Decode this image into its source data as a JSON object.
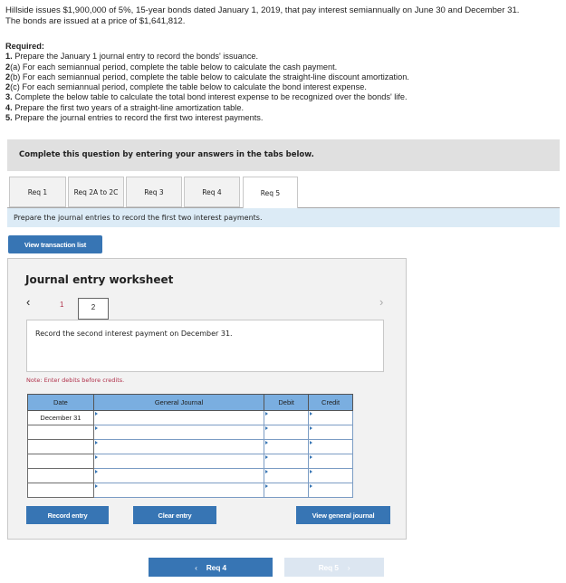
{
  "intro": {
    "line1": "Hillside issues $1,900,000 of 5%, 15-year bonds dated January 1, 2019, that pay interest semiannually on June 30 and December 31.",
    "line2": "The bonds are issued at a price of $1,641,812."
  },
  "required": {
    "heading": "Required:",
    "items": [
      {
        "num": "1.",
        "text": " Prepare the January 1 journal entry to record the bonds' issuance."
      },
      {
        "num": "2",
        "text": "(a) For each semiannual period, complete the table below to calculate the cash payment."
      },
      {
        "num": "2",
        "text": "(b) For each semiannual period, complete the table below to calculate the straight-line discount amortization."
      },
      {
        "num": "2",
        "text": "(c) For each semiannual period, complete the table below to calculate the bond interest expense."
      },
      {
        "num": "3.",
        "text": " Complete the below table to calculate the total bond interest expense to be recognized over the bonds' life."
      },
      {
        "num": "4.",
        "text": " Prepare the first two years of a straight-line amortization table."
      },
      {
        "num": "5.",
        "text": " Prepare the journal entries to record the first two interest payments."
      }
    ]
  },
  "instruction": "Complete this question by entering your answers in the tabs below.",
  "tabs": [
    "Req 1",
    "Req 2A to 2C",
    "Req 3",
    "Req 4",
    "Req 5"
  ],
  "active_tab": "Req 5",
  "tab_description": "Prepare the journal entries to record the first two interest payments.",
  "view_transaction_list": "View transaction list",
  "worksheet": {
    "title": "Journal entry worksheet",
    "pages": [
      "1",
      "2"
    ],
    "current_page": "2",
    "description": "Record the second interest payment on December 31.",
    "note": "Note: Enter debits before credits.",
    "columns": [
      "Date",
      "General Journal",
      "Debit",
      "Credit"
    ],
    "rows": [
      {
        "date": "December 31"
      },
      {
        "date": ""
      },
      {
        "date": ""
      },
      {
        "date": ""
      },
      {
        "date": ""
      },
      {
        "date": ""
      }
    ],
    "record_entry": "Record entry",
    "clear_entry": "Clear entry",
    "view_general_journal": "View general journal"
  },
  "nav": {
    "prev": "Req 4",
    "next": "Req 5"
  },
  "colors": {
    "button": "#3775b4",
    "header": "#7aaee0",
    "strip": "#dcebf6"
  }
}
